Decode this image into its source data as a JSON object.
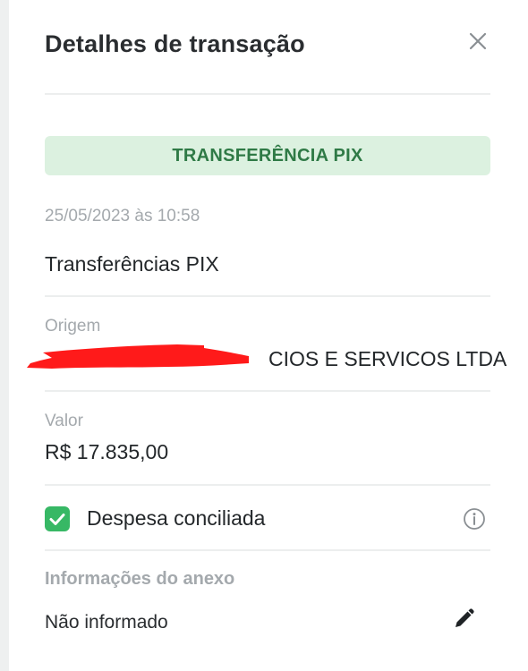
{
  "header": {
    "title": "Detalhes de transação",
    "close_icon": "close-icon"
  },
  "transaction": {
    "type_tag": "TRANSFERÊNCIA PIX",
    "datetime": "25/05/2023 às 10:58",
    "description": "Transferências PIX"
  },
  "origin": {
    "label": "Origem",
    "value": "CIOS E SERVICOS LTDA"
  },
  "amount": {
    "label": "Valor",
    "value": "R$ 17.835,00"
  },
  "reconciled": {
    "checked": true,
    "label": "Despesa conciliada",
    "info_icon": "info-icon"
  },
  "attachment": {
    "label": "Informações do anexo",
    "value": "Não informado",
    "edit_icon": "pencil-icon"
  },
  "colors": {
    "tag_bg": "#dcf1e0",
    "tag_text": "#2f7a46",
    "checkbox": "#37b865",
    "muted_text": "#a4a9ad",
    "redaction": "#ff1a1a"
  }
}
